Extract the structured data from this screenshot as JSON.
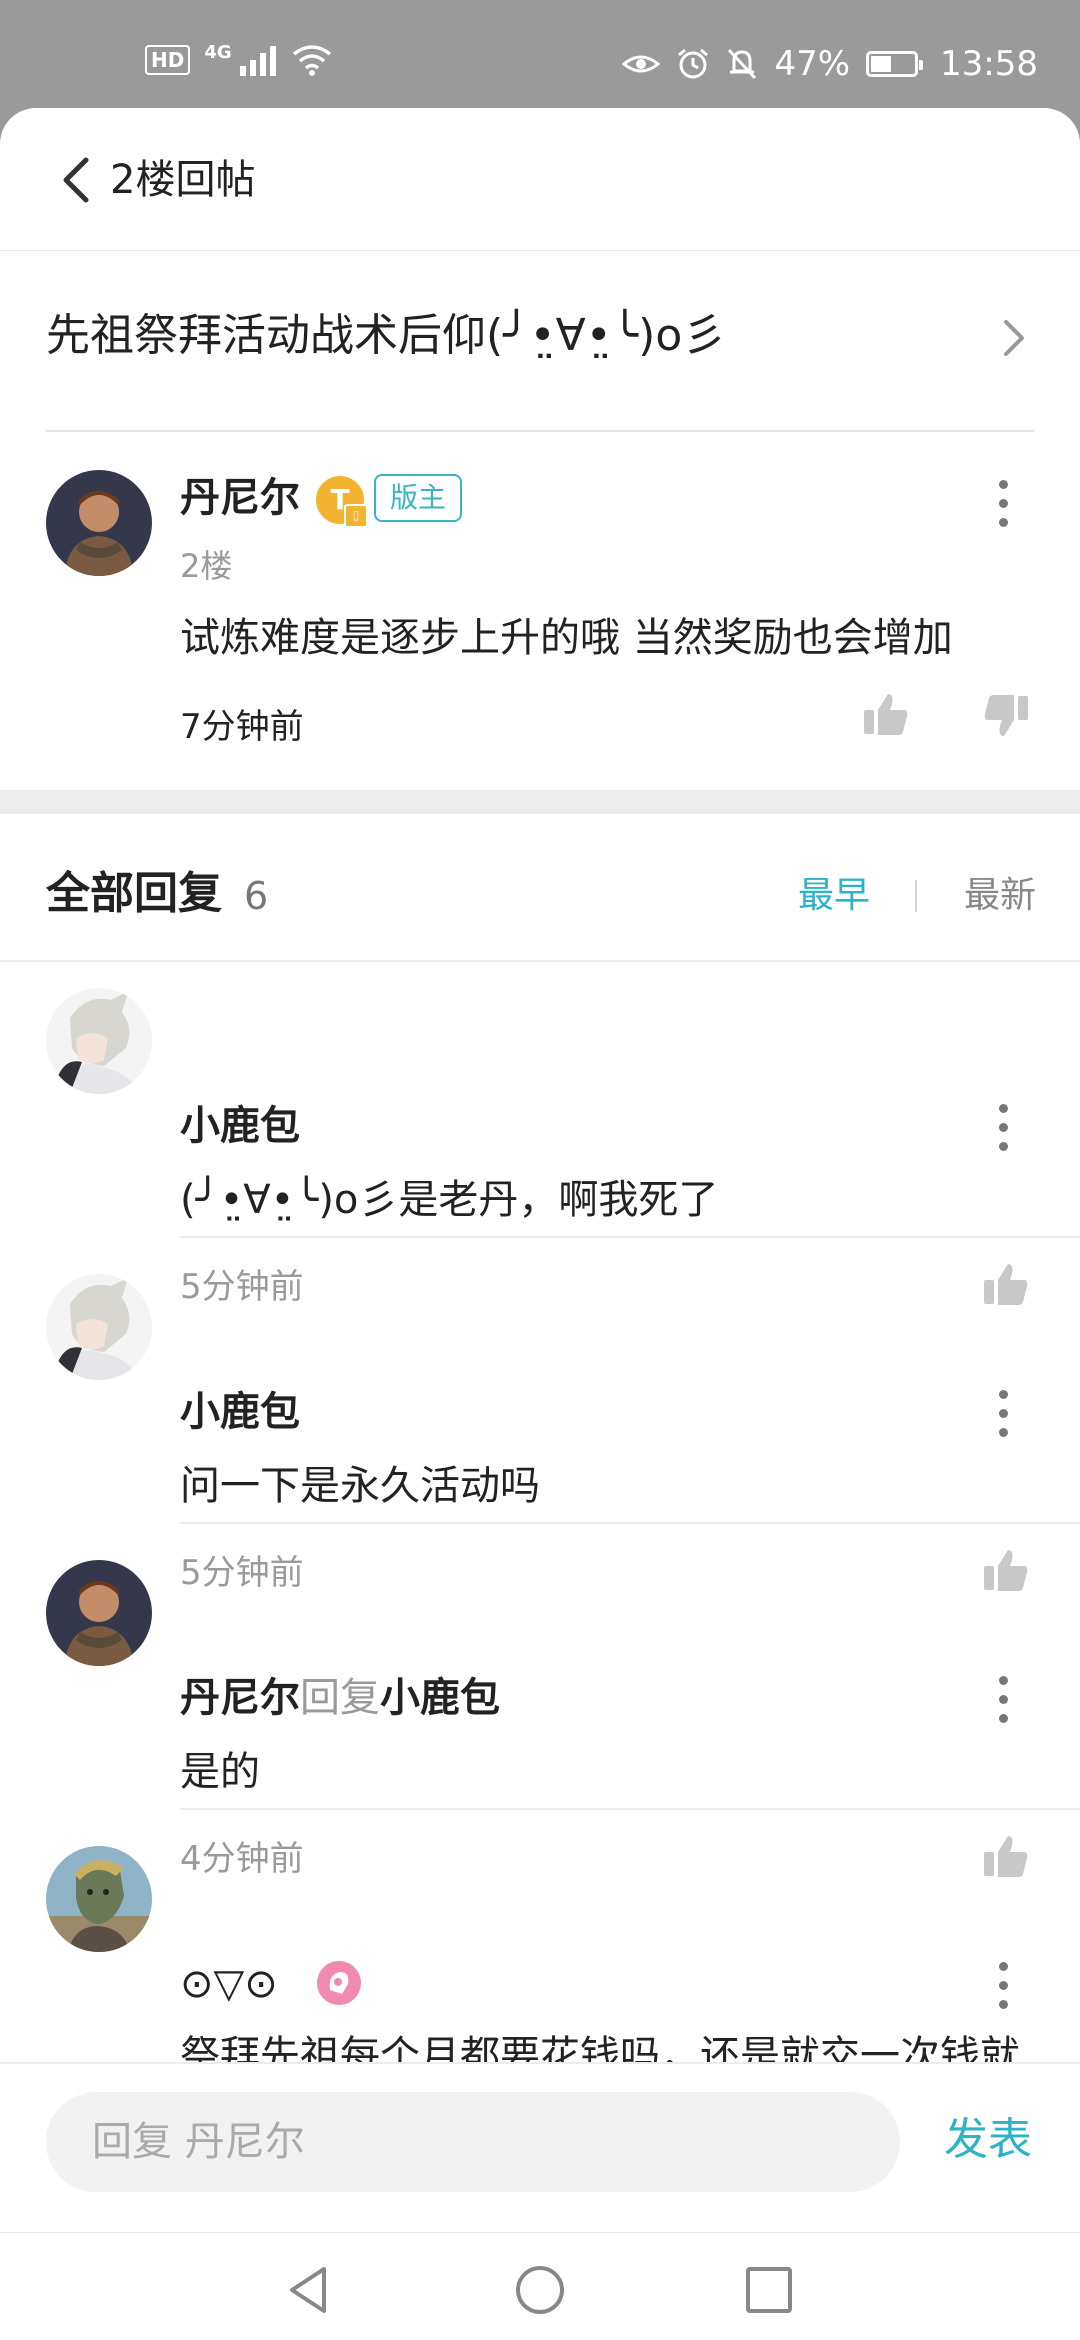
{
  "status_bar": {
    "hd": "HD",
    "network": "4G",
    "battery_percent": "47%",
    "battery_level": 0.47,
    "time": "13:58"
  },
  "header": {
    "title": "2楼回帖"
  },
  "thread": {
    "title": "先祖祭拜活动战术后仰(╯•̤∀•̤╰)o彡"
  },
  "post": {
    "author": "丹尼尔",
    "level_badge": "T",
    "role_badge": "版主",
    "floor": "2楼",
    "content": "试炼难度是逐步上升的哦 当然奖励也会增加",
    "time": "7分钟前"
  },
  "replies_header": {
    "title": "全部回复",
    "count": "6",
    "sort_earliest": "最早",
    "sort_latest": "最新"
  },
  "replies": [
    {
      "author": "小鹿包",
      "content": "(╯•̤∀•̤╰)o彡是老丹，啊我死了",
      "time": "5分钟前"
    },
    {
      "author": "小鹿包",
      "content": "问一下是永久活动吗",
      "time": "5分钟前"
    },
    {
      "author": "丹尼尔",
      "reply_word": "回复",
      "reply_to": "小鹿包",
      "content": "是的",
      "time": "4分钟前"
    },
    {
      "author": "⊙▽⊙",
      "content": "祭拜先祖每个月都要花钱吗，还是就交一次钱就可以了？"
    }
  ],
  "reply_bar": {
    "placeholder": "回复 丹尼尔",
    "publish_label": "发表"
  },
  "colors": {
    "accent": "#2cb3c6",
    "badge_gold": "#f2b430",
    "pink_badge": "#f08ab0"
  }
}
